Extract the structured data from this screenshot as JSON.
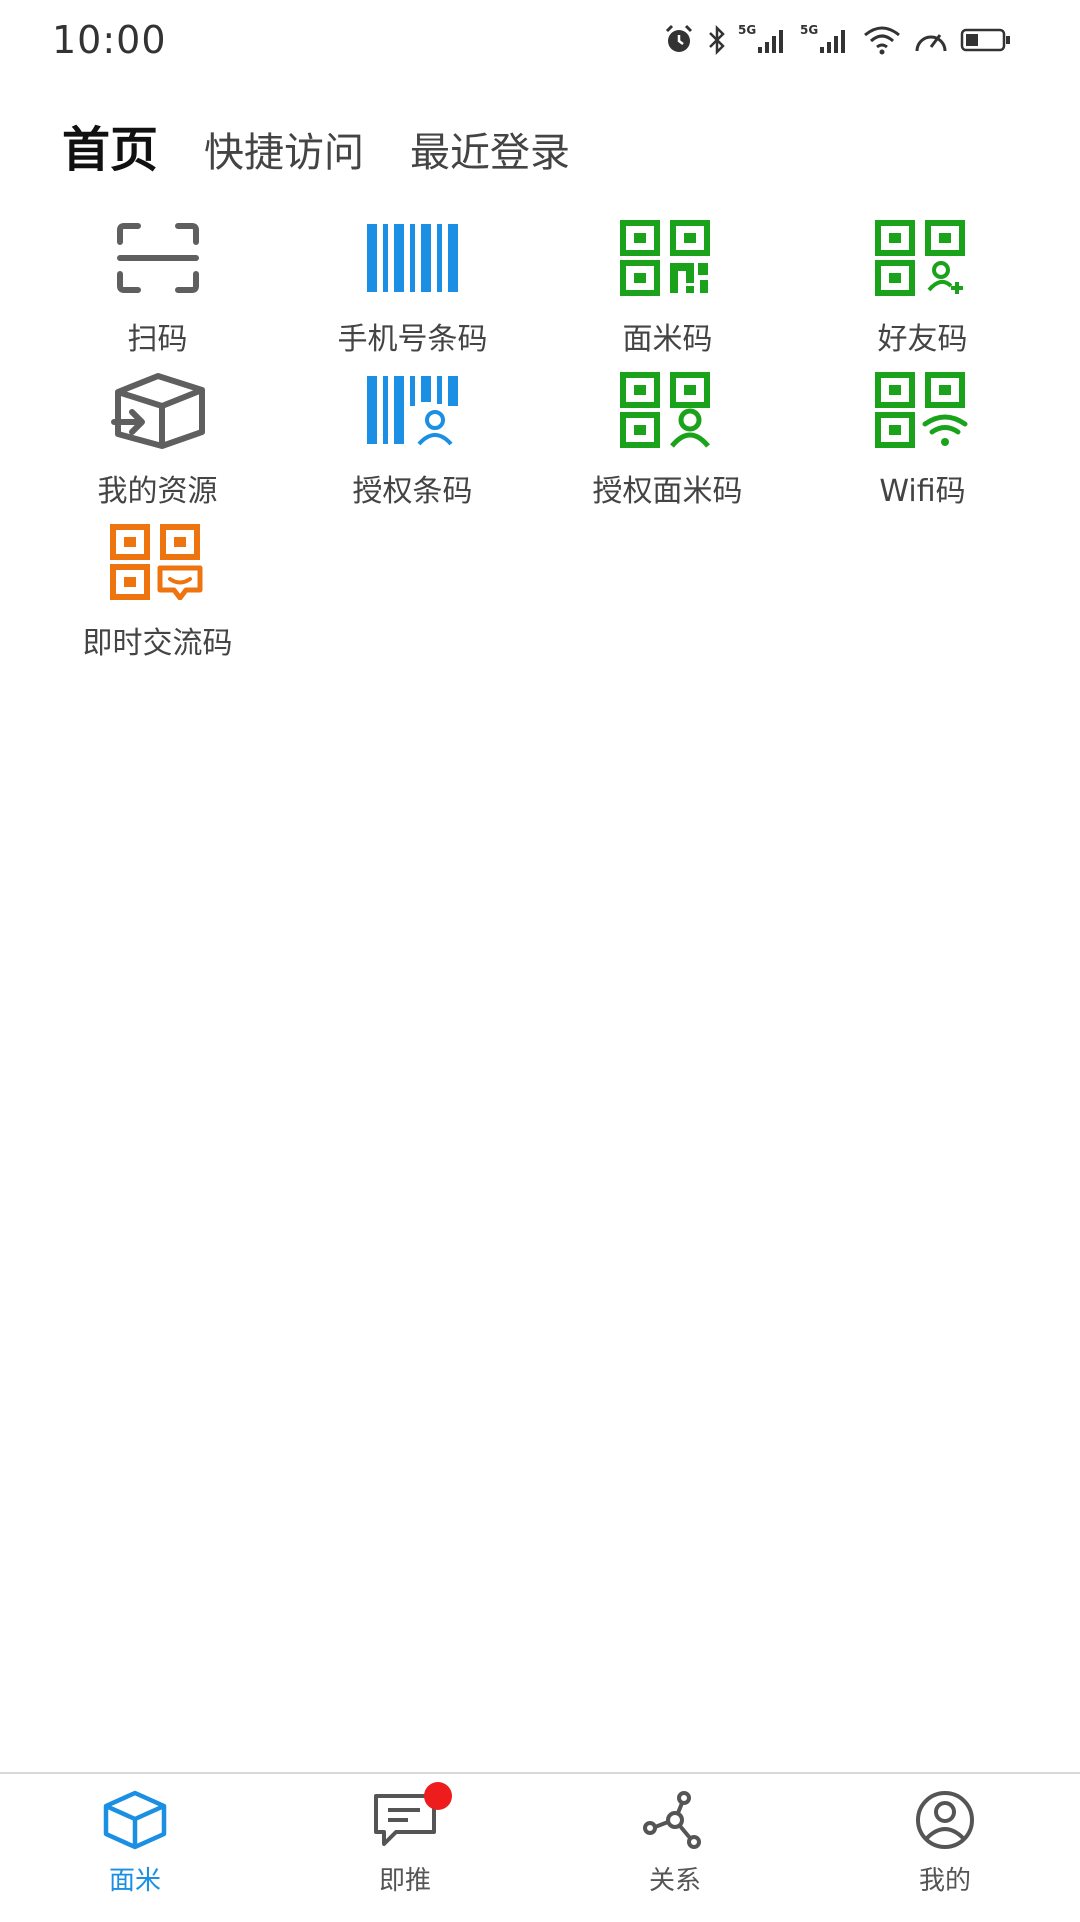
{
  "status_bar": {
    "time": "10:00",
    "icons": [
      "alarm-icon",
      "bluetooth-icon",
      "signal-5g-icon",
      "signal-5g-icon",
      "wifi-icon",
      "speed-icon",
      "battery-icon"
    ],
    "signal_label_1": "5G",
    "signal_label_2": "5G"
  },
  "tabs": [
    {
      "label": "首页",
      "active": true
    },
    {
      "label": "快捷访问",
      "active": false
    },
    {
      "label": "最近登录",
      "active": false
    }
  ],
  "grid": [
    {
      "label": "扫码",
      "icon": "scan-icon",
      "color": "#5f5f5f"
    },
    {
      "label": "手机号条码",
      "icon": "barcode-icon",
      "color": "#1a8fe3"
    },
    {
      "label": "面米码",
      "icon": "qr-code-icon",
      "color": "#1aa31a"
    },
    {
      "label": "好友码",
      "icon": "qr-add-friend-icon",
      "color": "#1aa31a"
    },
    {
      "label": "我的资源",
      "icon": "box-import-icon",
      "color": "#5f5f5f"
    },
    {
      "label": "授权条码",
      "icon": "barcode-user-icon",
      "color": "#1a8fe3"
    },
    {
      "label": "授权面米码",
      "icon": "qr-user-icon",
      "color": "#1aa31a"
    },
    {
      "label": "Wifi码",
      "icon": "qr-wifi-icon",
      "color": "#1aa31a"
    },
    {
      "label": "即时交流码",
      "icon": "qr-chat-icon",
      "color": "#ee7410"
    }
  ],
  "bottom_nav": [
    {
      "label": "面米",
      "icon": "cube-icon",
      "active": true
    },
    {
      "label": "即推",
      "icon": "chat-icon",
      "active": false,
      "badge": true
    },
    {
      "label": "关系",
      "icon": "network-icon",
      "active": false
    },
    {
      "label": "我的",
      "icon": "profile-icon",
      "active": false
    }
  ],
  "colors": {
    "accent": "#1a8fe3",
    "green": "#1aa31a",
    "orange": "#ee7410",
    "gray_icon": "#5f5f5f",
    "badge": "#ee1c1c"
  }
}
